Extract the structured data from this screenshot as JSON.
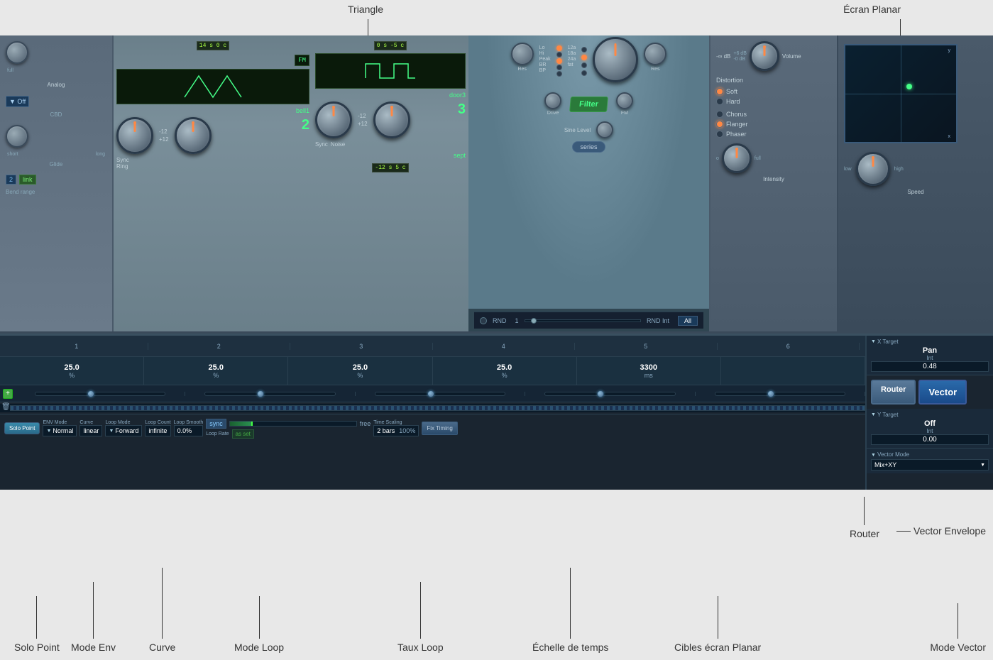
{
  "annotations": {
    "triangle_label": "Triangle",
    "ecran_planar_label": "Écran Planar",
    "router_label": "Router",
    "vector_envelope_label": "Vector Envelope",
    "mode_loop_label": "Mode Loop",
    "taux_loop_label": "Taux Loop",
    "echelle_de_temps_label": "Échelle de temps",
    "cibles_ecran_planar_label": "Cibles écran Planar",
    "curve_label": "Curve",
    "mode_env_label": "Mode Env",
    "solo_point_label": "Solo Point",
    "mode_vector_label": "Mode Vector"
  },
  "synth": {
    "analog_label": "Analog",
    "cbd_label": "CBD",
    "glide_short": "short",
    "glide_long": "long",
    "bend_range_label": "Bend range",
    "lcd1": "14 s  0 c",
    "lcd2": "0 s  -5 c",
    "lcd3": "-12 s  5 c",
    "osc1_mode": "Sync",
    "osc1_wave": "Ring",
    "osc2_mode": "Sync",
    "osc2_wave": "Noise",
    "fm_label": "FM",
    "osc1_name": "bell1",
    "osc2_name": "door3",
    "osc3_name": "sept",
    "osc_numbers": [
      "2",
      "3"
    ]
  },
  "filter": {
    "res_label": "Res",
    "lo_label": "Lo",
    "hi_label": "Hi",
    "peak_label": "Peak",
    "br_label": "BR",
    "bp_label": "BP",
    "freq_12a": "12a",
    "freq_18a": "18a",
    "freq_24a": "24a",
    "fat_label": "fat",
    "drive_label": "Drive",
    "fm_label": "FM",
    "filter_label": "Filter",
    "series_btn": "series",
    "sine_level_label": "Sine Level",
    "rnd_label": "RND",
    "rnd_int_label": "RND Int",
    "all_label": "All"
  },
  "effects": {
    "volume_label": "Volume",
    "volume_db_high": "+6 dB",
    "volume_db_low": "-0 dB",
    "volume_db_current": "-∞ dB",
    "distortion_label": "Distortion",
    "soft_label": "Soft",
    "hard_label": "Hard",
    "chorus_label": "Chorus",
    "flanger_label": "Flanger",
    "phaser_label": "Phaser",
    "intensity_label": "Intensity",
    "intensity_low": "o",
    "intensity_full": "full",
    "speed_label": "Speed",
    "speed_low": "low",
    "speed_high": "high"
  },
  "planar": {
    "title": "Écran Planar",
    "y_label": "y",
    "x_label": "x"
  },
  "envelope": {
    "col_labels": [
      "1",
      "2",
      "3",
      "4",
      "5",
      "6"
    ],
    "values": [
      "25.0",
      "25.0",
      "25.0",
      "25.0",
      "3300",
      ""
    ],
    "units": [
      "%",
      "%",
      "%",
      "%",
      "ms",
      ""
    ],
    "solo_point_btn": "Solo Point",
    "env_mode_label": "ENV Mode",
    "env_mode_value": "Normal",
    "curve_label": "Curve",
    "curve_value": "linear",
    "loop_mode_label": "Loop Mode",
    "loop_mode_value": "Forward",
    "loop_count_label": "Loop Count",
    "loop_count_value": "infinite",
    "loop_smooth_label": "Loop Smooth",
    "loop_smooth_value": "0.0%",
    "sync_label": "sync",
    "loop_rate_label": "Loop Rate",
    "free_label": "free",
    "as_set_btn": "as set",
    "time_scaling_label": "Time Scaling",
    "time_scaling_value": "2 bars",
    "time_scaling_pct": "100%",
    "fix_timing_btn": "Fix Timing"
  },
  "router": {
    "router_btn": "Router",
    "vector_btn": "Vector",
    "x_target_label": "X Target",
    "x_target_value": "Pan",
    "x_int_label": "Int",
    "x_int_value": "0.48",
    "y_target_label": "Y Target",
    "y_target_value": "Off",
    "y_int_label": "Int",
    "y_int_value": "0.00",
    "vector_mode_label": "Vector Mode",
    "vector_mode_value": "Mix+XY"
  }
}
